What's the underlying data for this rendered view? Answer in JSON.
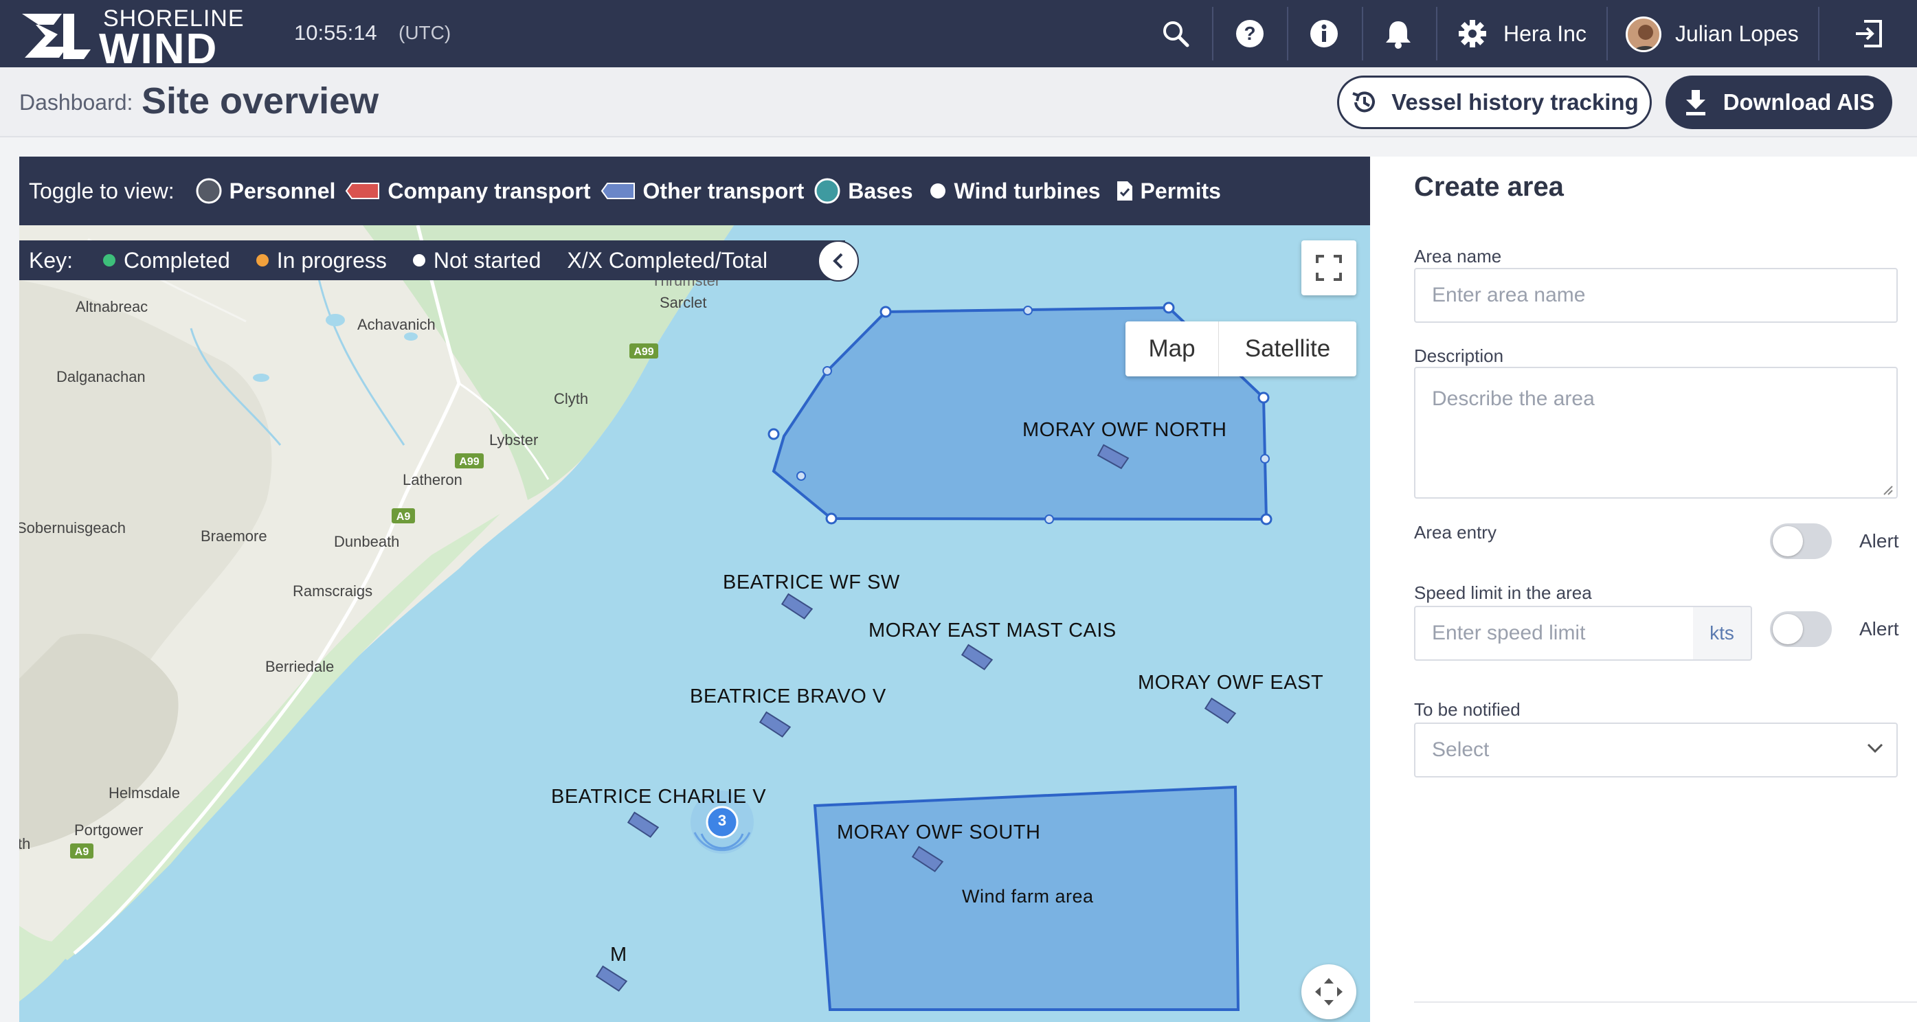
{
  "brand": {
    "sub": "SHORELINE",
    "main": "WIND"
  },
  "header": {
    "time": "10:55:14",
    "timezone": "(UTC)",
    "icons": [
      "search-icon",
      "help-icon",
      "info-icon",
      "bell-icon",
      "gear-icon",
      "logout-icon"
    ],
    "organization": "Hera Inc",
    "user": "Julian Lopes"
  },
  "page": {
    "crumb": "Dashboard:",
    "title": "Site overview",
    "history_button": "Vessel history tracking",
    "download_button": "Download AIS"
  },
  "toggle": {
    "label": "Toggle to view:",
    "items": [
      "Personnel",
      "Company transport",
      "Other transport",
      "Bases",
      "Wind turbines",
      "Permits"
    ]
  },
  "key": {
    "label": "Key:",
    "items": [
      {
        "label": "Completed",
        "color": "#3dbf7a"
      },
      {
        "label": "In progress",
        "color": "#f2a13c"
      },
      {
        "label": "Not started",
        "color": "#ffffff"
      }
    ],
    "ratio": "X/X Completed/Total"
  },
  "map": {
    "map_option": "Map",
    "satellite_option": "Satellite",
    "cluster_count": "3",
    "place_labels": [
      "Altnabreac",
      "Achavanich",
      "Sarclet",
      "Dalganachan",
      "Clyth",
      "Lybster",
      "Latheron",
      "Sobernuisgeach",
      "Braemore",
      "Dunbeath",
      "Ramscraigs",
      "Berriedale",
      "Helmsdale",
      "Portgower",
      "th",
      "Thrumster"
    ],
    "road_labels": [
      "A99",
      "A99",
      "A9",
      "A9"
    ],
    "sites": [
      "MORAY OWF NORTH",
      "BEATRICE WF SW",
      "MORAY EAST MAST CAIS",
      "MORAY OWF EAST",
      "BEATRICE BRAVO V",
      "BEATRICE CHARLIE V",
      "MORAY OWF SOUTH",
      "M"
    ],
    "area_label": "Wind farm area"
  },
  "panel": {
    "title": "Create area",
    "area_name_label": "Area name",
    "area_name_placeholder": "Enter area name",
    "description_label": "Description",
    "description_placeholder": "Describe the area",
    "area_entry_label": "Area entry",
    "alert_label": "Alert",
    "speed_label": "Speed limit in the area",
    "speed_placeholder": "Enter speed limit",
    "speed_unit": "kts",
    "notify_label": "To be notified",
    "notify_placeholder": "Select"
  }
}
